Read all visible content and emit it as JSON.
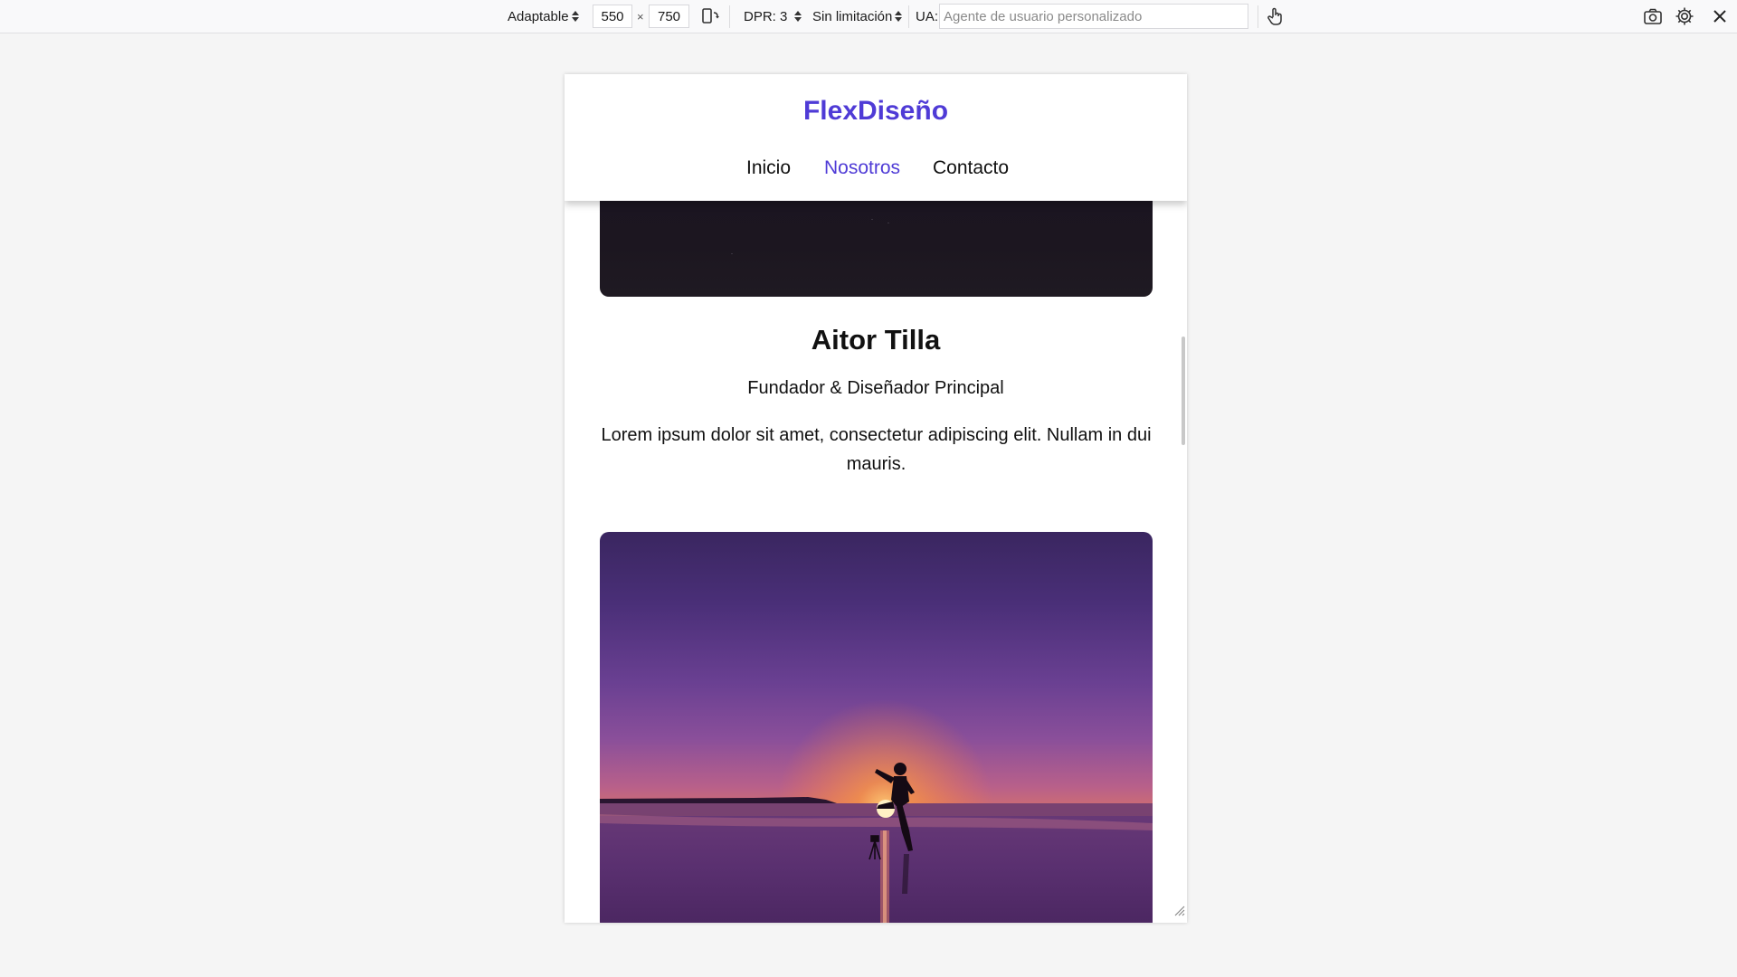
{
  "toolbar": {
    "device_mode": "Adaptable",
    "width": "550",
    "times": "×",
    "height": "750",
    "dpr": "DPR: 3",
    "throttling": "Sin limitación",
    "ua_label": "UA:",
    "ua_placeholder": "Agente de usuario personalizado"
  },
  "icons": {
    "rotate": "rotate-device-icon",
    "touch": "touch-simulation-icon",
    "screenshot": "screenshot-icon",
    "settings": "gear-icon",
    "close": "close-icon",
    "resize": "resize-grip-icon"
  },
  "site": {
    "brand": "FlexDiseño",
    "nav": [
      {
        "label": "Inicio",
        "active": false
      },
      {
        "label": "Nosotros",
        "active": true
      },
      {
        "label": "Contacto",
        "active": false
      }
    ],
    "accent_color": "#4f3bd6"
  },
  "team_member": {
    "name": "Aitor Tilla",
    "role": "Fundador & Diseñador Principal",
    "bio": "Lorem ipsum dolor sit amet, consectetur adipiscing elit. Nullam in dui mauris."
  }
}
